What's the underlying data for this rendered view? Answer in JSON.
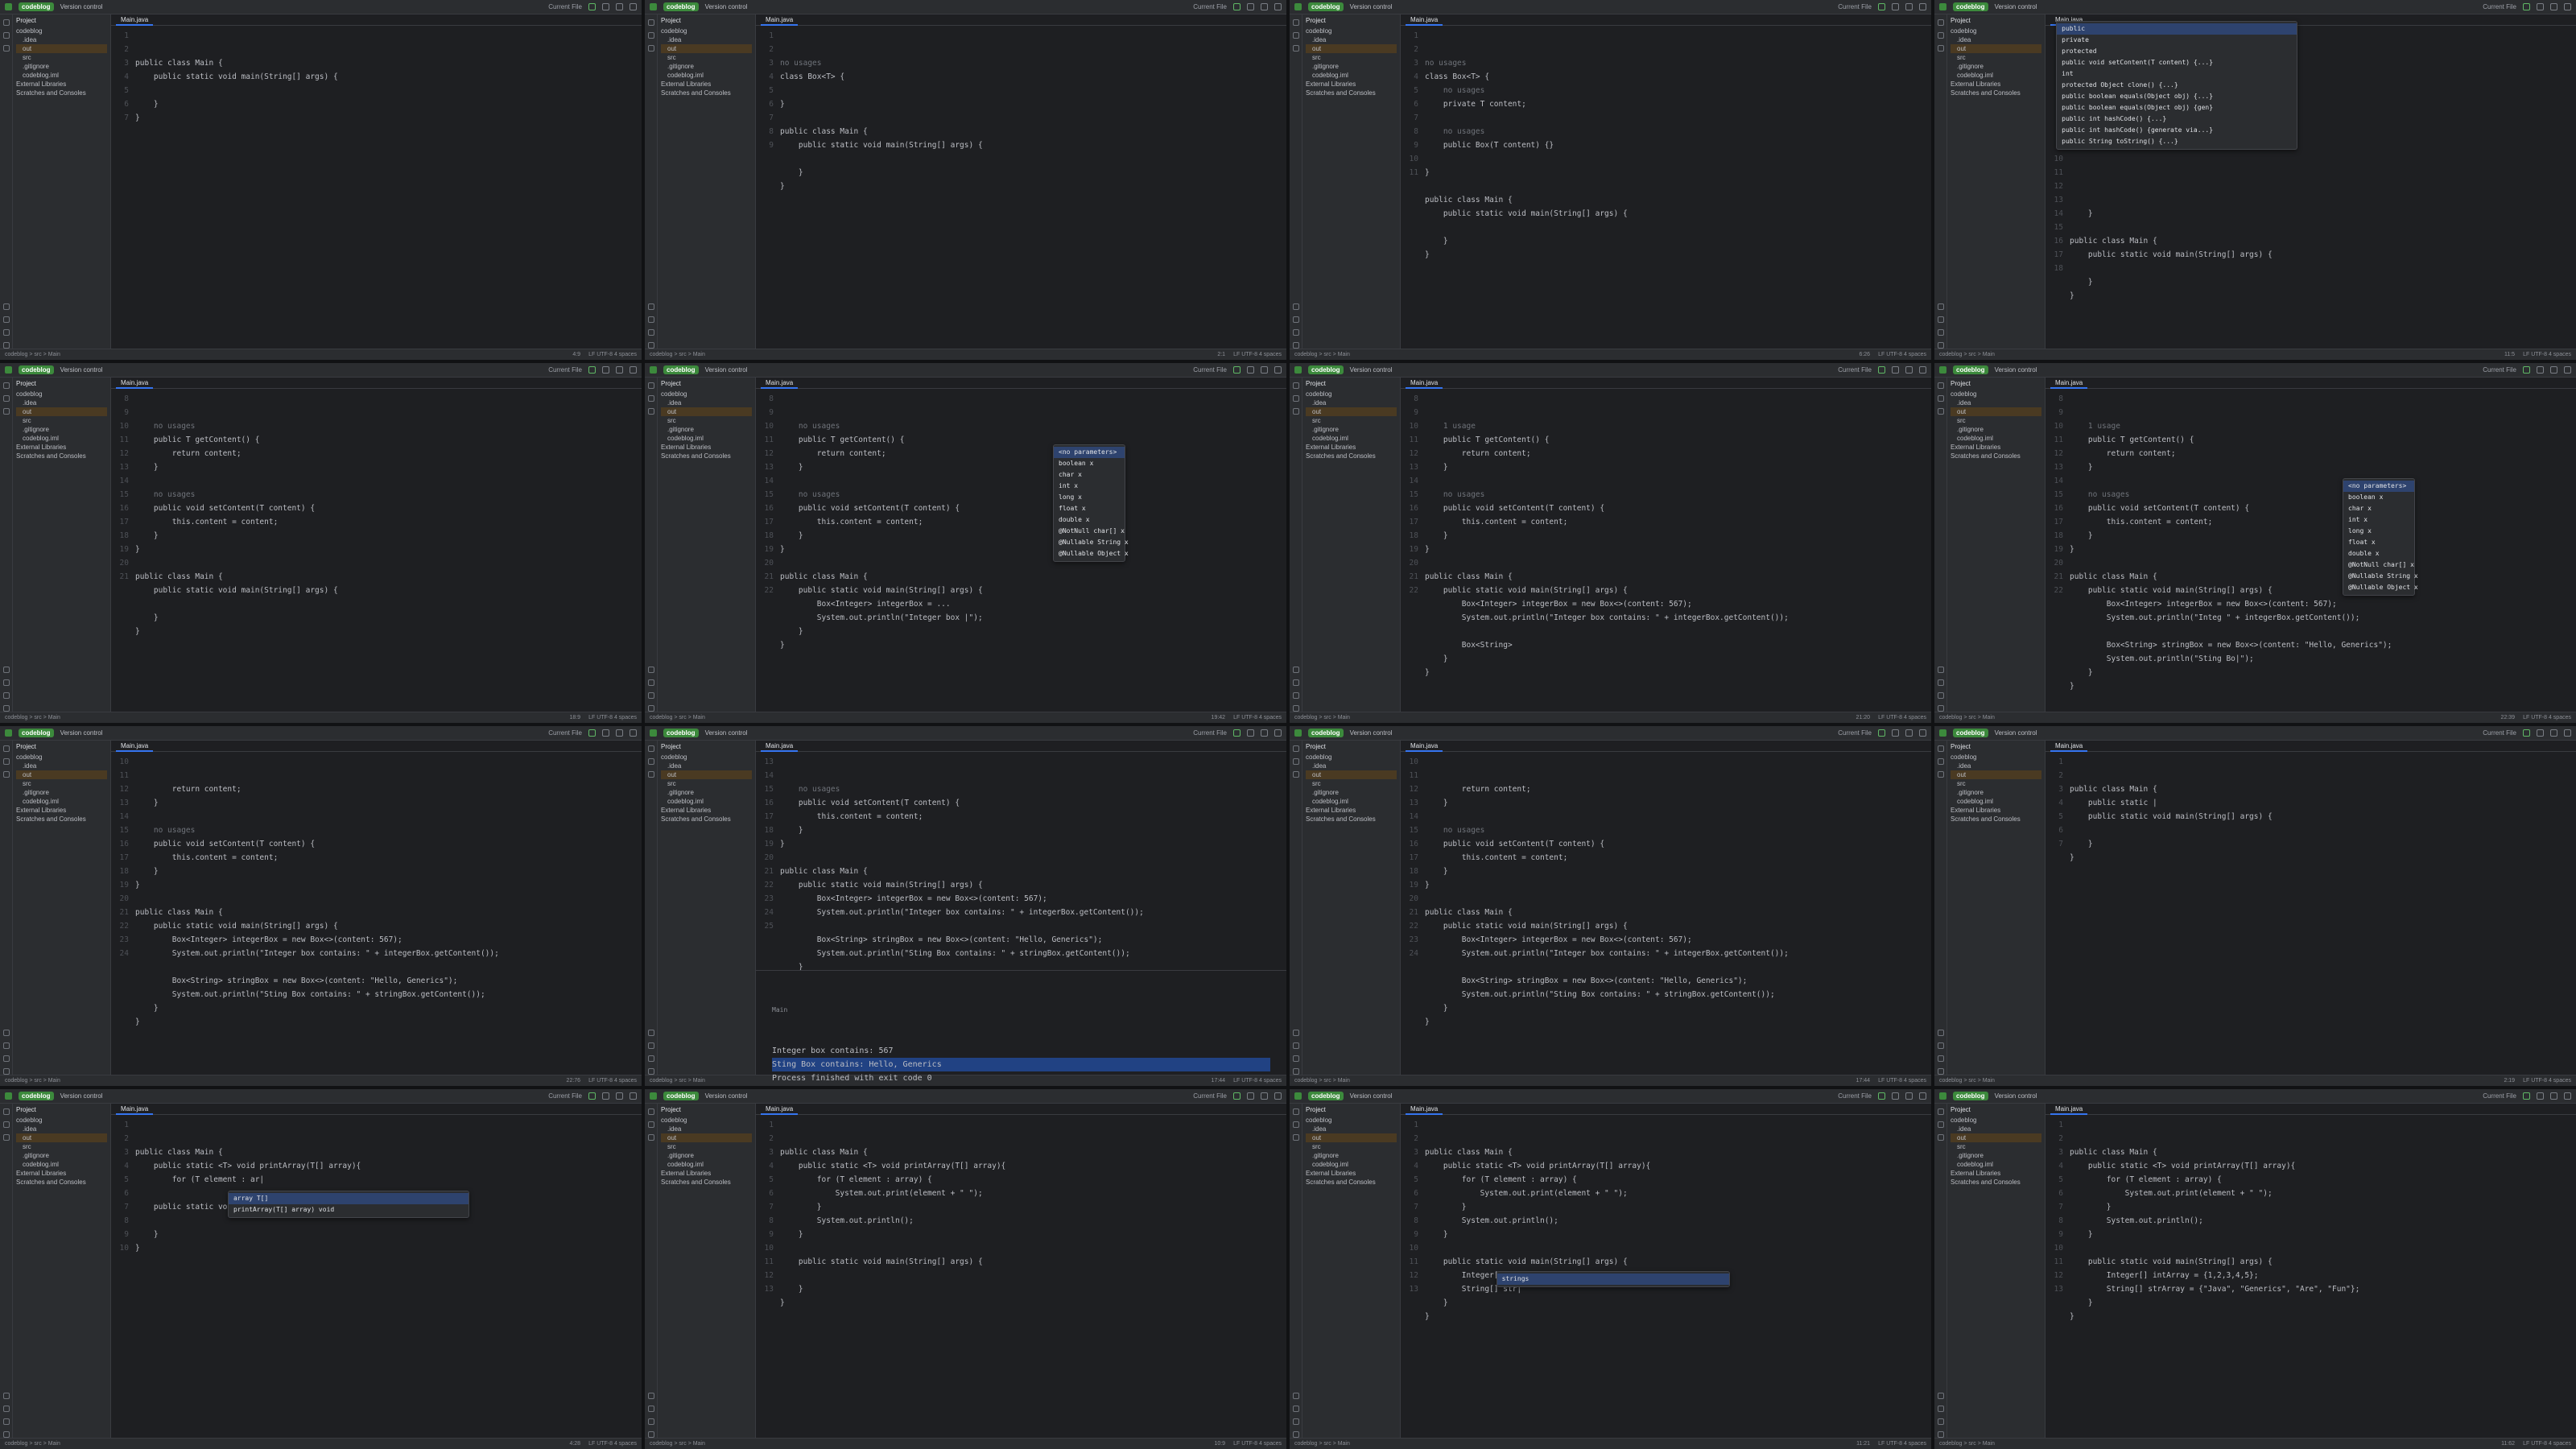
{
  "common": {
    "project": "codeblog",
    "vcs": "Version control",
    "run_config": "Current File",
    "file_tab": "Main.java",
    "tree_header": "Project",
    "tree": [
      "codeblog",
      ".idea",
      "out",
      "src",
      ".gitignore",
      "codeblog.iml",
      "External Libraries",
      "Scratches and Consoles"
    ],
    "status_path": "codeblog > src > Main",
    "status_right": "LF   UTF-8   4 spaces"
  },
  "panels": [
    {
      "gutter": [
        "1",
        "2",
        "3",
        "4",
        "5",
        "6",
        "7"
      ],
      "code": [
        "public class Main {",
        "    public static void main(String[] args) {",
        "",
        "    }",
        "}",
        "",
        ""
      ],
      "status_pos": "4:9"
    },
    {
      "gutter": [
        "1",
        "2",
        "3",
        "4",
        "5",
        "6",
        "7",
        "8",
        "9"
      ],
      "code": [
        "no usages",
        "class Box<T> {",
        "",
        "}",
        "",
        "public class Main {",
        "    public static void main(String[] args) {",
        "",
        "    }",
        "}"
      ],
      "status_pos": "2:1"
    },
    {
      "gutter": [
        "1",
        "2",
        "3",
        "4",
        "5",
        "6",
        "7",
        "8",
        "9",
        "10",
        "11"
      ],
      "code": [
        "no usages",
        "class Box<T> {",
        "    no usages",
        "    private T content;",
        "",
        "    no usages",
        "    public Box(T content) {}",
        "",
        "}",
        "",
        "public class Main {",
        "    public static void main(String[] args) {",
        "",
        "    }",
        "}"
      ],
      "status_pos": "6:26"
    },
    {
      "gutter": [
        "1",
        "2",
        "3",
        "4",
        "5",
        "6",
        "7",
        "8",
        "9",
        "10",
        "11",
        "12",
        "13",
        "14",
        "15",
        "16",
        "17",
        "18"
      ],
      "code": [
        "",
        "",
        "",
        "",
        "",
        "",
        "",
        "",
        "",
        "",
        "",
        "    }",
        "",
        "public class Main {",
        "    public static void main(String[] args) {",
        "",
        "    }",
        "}"
      ],
      "popup": [
        "public",
        "private",
        "protected",
        "public void setContent(T content) {...}",
        "int",
        "protected Object clone() {...}",
        "public boolean equals(Object obj) {...}",
        "public boolean equals(Object obj) {gen}",
        "public int hashCode() {...}",
        "public int hashCode() {generate via...}",
        "public String toString() {...}"
      ],
      "status_pos": "11:5"
    },
    {
      "gutter": [
        "8",
        "9",
        "10",
        "11",
        "12",
        "13",
        "14",
        "15",
        "16",
        "17",
        "18",
        "19",
        "20",
        "21"
      ],
      "code": [
        "    no usages",
        "    public T getContent() {",
        "        return content;",
        "    }",
        "",
        "    no usages",
        "    public void setContent(T content) {",
        "        this.content = content;",
        "    }",
        "}",
        "",
        "public class Main {",
        "    public static void main(String[] args) {",
        "",
        "    }",
        "}"
      ],
      "status_pos": "18:9"
    },
    {
      "gutter": [
        "8",
        "9",
        "10",
        "11",
        "12",
        "13",
        "14",
        "15",
        "16",
        "17",
        "18",
        "19",
        "20",
        "21",
        "22"
      ],
      "code": [
        "    no usages",
        "    public T getContent() {",
        "        return content;",
        "    }",
        "",
        "    no usages",
        "    public void setContent(T content) {",
        "        this.content = content;",
        "    }",
        "}",
        "",
        "public class Main {",
        "    public static void main(String[] args) {",
        "        Box<Integer> integerBox = ...",
        "        System.out.println(\"Integer box |\");",
        "    }",
        "}"
      ],
      "popup": [
        "<no parameters>",
        "boolean x",
        "char x",
        "int x",
        "long x",
        "float x",
        "double x",
        "@NotNull char[] x",
        "@Nullable String x",
        "@Nullable Object x"
      ],
      "status_pos": "19:42"
    },
    {
      "gutter": [
        "8",
        "9",
        "10",
        "11",
        "12",
        "13",
        "14",
        "15",
        "16",
        "17",
        "18",
        "19",
        "20",
        "21",
        "22"
      ],
      "code": [
        "    1 usage",
        "    public T getContent() {",
        "        return content;",
        "    }",
        "",
        "    no usages",
        "    public void setContent(T content) {",
        "        this.content = content;",
        "    }",
        "}",
        "",
        "public class Main {",
        "    public static void main(String[] args) {",
        "        Box<Integer> integerBox = new Box<>(content: 567);",
        "        System.out.println(\"Integer box contains: \" + integerBox.getContent());",
        "",
        "        Box<String>",
        "    }",
        "}"
      ],
      "status_pos": "21:20"
    },
    {
      "gutter": [
        "8",
        "9",
        "10",
        "11",
        "12",
        "13",
        "14",
        "15",
        "16",
        "17",
        "18",
        "19",
        "20",
        "21",
        "22"
      ],
      "code": [
        "    1 usage",
        "    public T getContent() {",
        "        return content;",
        "    }",
        "",
        "    no usages",
        "    public void setContent(T content) {",
        "        this.content = content;",
        "    }",
        "}",
        "",
        "public class Main {",
        "    public static void main(String[] args) {",
        "        Box<Integer> integerBox = new Box<>(content: 567);",
        "        System.out.println(\"Integ \" + integerBox.getContent());",
        "",
        "        Box<String> stringBox = new Box<>(content: \"Hello, Generics\");",
        "        System.out.println(\"Sting Bo|\");",
        "    }",
        "}"
      ],
      "popup": [
        "<no parameters>",
        "boolean x",
        "char x",
        "int x",
        "long x",
        "float x",
        "double x",
        "@NotNull char[] x",
        "@Nullable String x",
        "@Nullable Object x"
      ],
      "status_pos": "22:39"
    },
    {
      "gutter": [
        "10",
        "11",
        "12",
        "13",
        "14",
        "15",
        "16",
        "17",
        "18",
        "19",
        "20",
        "21",
        "22",
        "23",
        "24"
      ],
      "code": [
        "        return content;",
        "    }",
        "",
        "    no usages",
        "    public void setContent(T content) {",
        "        this.content = content;",
        "    }",
        "}",
        "",
        "public class Main {",
        "    public static void main(String[] args) {",
        "        Box<Integer> integerBox = new Box<>(content: 567);",
        "        System.out.println(\"Integer box contains: \" + integerBox.getContent());",
        "",
        "        Box<String> stringBox = new Box<>(content: \"Hello, Generics\");",
        "        System.out.println(\"Sting Box contains: \" + stringBox.getContent());",
        "    }",
        "}"
      ],
      "status_pos": "22:76"
    },
    {
      "gutter": [
        "13",
        "14",
        "15",
        "16",
        "17",
        "18",
        "19",
        "20",
        "21",
        "22",
        "23",
        "24",
        "25"
      ],
      "code": [
        "    no usages",
        "    public void setContent(T content) {",
        "        this.content = content;",
        "    }",
        "}",
        "",
        "public class Main {",
        "    public static void main(String[] args) {",
        "        Box<Integer> integerBox = new Box<>(content: 567);",
        "        System.out.println(\"Integer box contains: \" + integerBox.getContent());",
        "",
        "        Box<String> stringBox = new Box<>(content: \"Hello, Generics\");",
        "        System.out.println(\"Sting Box contains: \" + stringBox.getContent());",
        "    }",
        "}"
      ],
      "run": {
        "tab": "Main",
        "lines": [
          "Integer box contains: 567",
          "Sting Box contains: Hello, Generics",
          "",
          "Process finished with exit code 0"
        ]
      },
      "status_pos": "17:44"
    },
    {
      "gutter": [
        "10",
        "11",
        "12",
        "13",
        "14",
        "15",
        "16",
        "17",
        "18",
        "19",
        "20",
        "21",
        "22",
        "23",
        "24"
      ],
      "code": [
        "        return content;",
        "    }",
        "",
        "    no usages",
        "    public void setContent(T content) {",
        "        this.content = content;",
        "    }",
        "}",
        "",
        "public class Main {",
        "    public static void main(String[] args) {",
        "        Box<Integer> integerBox = new Box<>(content: 567);",
        "        System.out.println(\"Integer box contains: \" + integerBox.getContent());",
        "",
        "        Box<String> stringBox = new Box<>(content: \"Hello, Generics\");",
        "        System.out.println(\"Sting Box contains: \" + stringBox.getContent());",
        "    }",
        "}"
      ],
      "status_pos": "17:44"
    },
    {
      "gutter": [
        "1",
        "2",
        "3",
        "4",
        "5",
        "6",
        "7"
      ],
      "code": [
        "public class Main {",
        "    public static |",
        "    public static void main(String[] args) {",
        "",
        "    }",
        "}"
      ],
      "status_pos": "2:19"
    },
    {
      "gutter": [
        "1",
        "2",
        "3",
        "4",
        "5",
        "6",
        "7",
        "8",
        "9",
        "10"
      ],
      "code": [
        "public class Main {",
        "    public static <T> void printArray(T[] array){",
        "        for (T element : ar|",
        "",
        "    public static void main(String[] args) {",
        "",
        "    }",
        "}"
      ],
      "popup": [
        "array                              T[]",
        "printArray(T[] array)            void"
      ],
      "status_pos": "4:28"
    },
    {
      "gutter": [
        "1",
        "2",
        "3",
        "4",
        "5",
        "6",
        "7",
        "8",
        "9",
        "10",
        "11",
        "12",
        "13"
      ],
      "code": [
        "public class Main {",
        "    public static <T> void printArray(T[] array){",
        "        for (T element : array) {",
        "            System.out.print(element + \" \");",
        "        }",
        "        System.out.println();",
        "    }",
        "",
        "    public static void main(String[] args) {",
        "",
        "    }",
        "}"
      ],
      "status_pos": "10:9"
    },
    {
      "gutter": [
        "1",
        "2",
        "3",
        "4",
        "5",
        "6",
        "7",
        "8",
        "9",
        "10",
        "11",
        "12",
        "13"
      ],
      "code": [
        "public class Main {",
        "    public static <T> void printArray(T[] array){",
        "        for (T element : array) {",
        "            System.out.print(element + \" \");",
        "        }",
        "        System.out.println();",
        "    }",
        "",
        "    public static void main(String[] args) {",
        "        Integer[] intArray = {1,2,3,4,5};",
        "        String[] str|",
        "    }",
        "}"
      ],
      "popup": [
        "strings"
      ],
      "status_pos": "11:21"
    },
    {
      "gutter": [
        "1",
        "2",
        "3",
        "4",
        "5",
        "6",
        "7",
        "8",
        "9",
        "10",
        "11",
        "12",
        "13"
      ],
      "code": [
        "public class Main {",
        "    public static <T> void printArray(T[] array){",
        "        for (T element : array) {",
        "            System.out.print(element + \" \");",
        "        }",
        "        System.out.println();",
        "    }",
        "",
        "    public static void main(String[] args) {",
        "        Integer[] intArray = {1,2,3,4,5};",
        "        String[] strArray = {\"Java\", \"Generics\", \"Are\", \"Fun\"};",
        "    }",
        "}"
      ],
      "status_pos": "11:62"
    }
  ]
}
